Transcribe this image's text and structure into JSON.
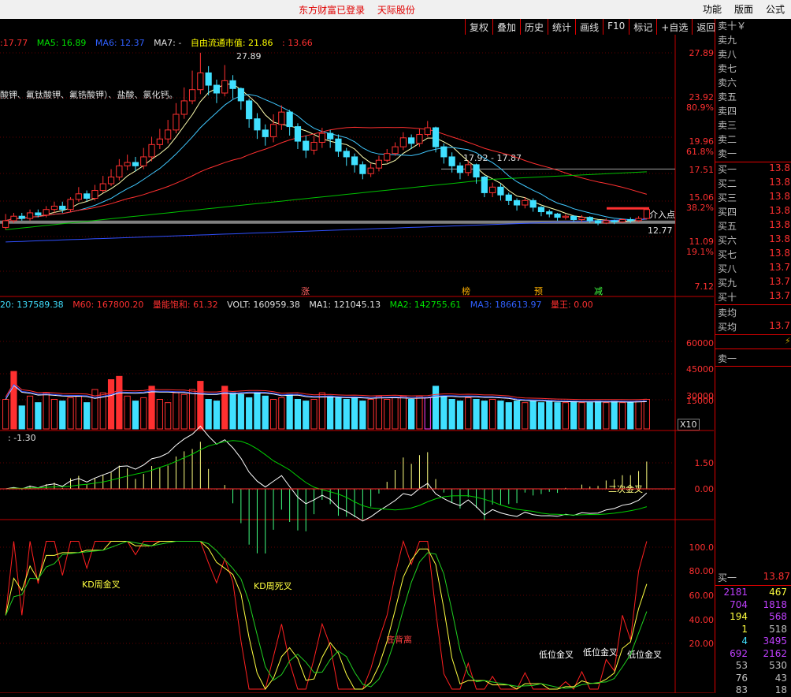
{
  "top": {
    "login": "东方财富已登录",
    "stock": "天际股份"
  },
  "top_menu": [
    "功能",
    "版面",
    "公式"
  ],
  "toolbar": [
    "复权",
    "叠加",
    "历史",
    "统计",
    "画线",
    "F10",
    "标记",
    "+自选",
    "返回"
  ],
  "main_legend": [
    {
      "t": ":17.77",
      "c": "#ff3030"
    },
    {
      "t": "MA5: 16.89",
      "c": "#00e000"
    },
    {
      "t": "MA6: 12.37",
      "c": "#3060ff"
    },
    {
      "t": "MA7: -",
      "c": "#e0e0e0"
    },
    {
      "t": "自由流通市值: 21.86",
      "c": "#ffff00"
    },
    {
      "t": ": 13.66",
      "c": "#ff3030"
    }
  ],
  "main_note": "酸钾、氟钛酸钾、氟锆酸钾）、盐酸、氯化钙。",
  "main_annotations": {
    "high": "27.89",
    "mid": "17.92 - 17.87",
    "low": "12.77",
    "entry": "介入点"
  },
  "price_axis": [
    "27.89",
    "23.92",
    "80.9%",
    "19.96",
    "61.8%",
    "17.51",
    "15.06",
    "38.2%",
    "11.09",
    "19.1%",
    "7.12"
  ],
  "event_markers": [
    "涨",
    "榜",
    "预",
    "减"
  ],
  "vol_legend": [
    {
      "t": "20: 137589.38",
      "c": "#40e0ff"
    },
    {
      "t": "M60: 167800.20",
      "c": "#ff3030"
    },
    {
      "t": "量能饱和: 61.32",
      "c": "#ff3030"
    },
    {
      "t": "VOLT: 160959.38",
      "c": "#e0e0e0"
    },
    {
      "t": "MA1: 121045.13",
      "c": "#e0e0e0"
    },
    {
      "t": "MA2: 142755.61",
      "c": "#00e000"
    },
    {
      "t": "MA3: 186613.97",
      "c": "#3060ff"
    },
    {
      "t": "量王: 0.00",
      "c": "#ff3030"
    }
  ],
  "vol_axis": [
    "60000",
    "45000",
    "30000",
    "15000"
  ],
  "vol_unit": "X10",
  "macd_legend": ": -1.30",
  "macd_axis": [
    "1.50",
    "0.00"
  ],
  "macd_note": "二次金叉",
  "kd_axis": [
    "100.0",
    "80.00",
    "60.00",
    "40.00",
    "20.00"
  ],
  "kd_labels": [
    "KD周金叉",
    "KD周死叉",
    "底背离",
    "低位金叉",
    "低位金叉",
    "低位金叉"
  ],
  "sell_levels": [
    "卖十￥",
    "卖九",
    "卖八",
    "卖七",
    "卖六",
    "卖五",
    "卖四",
    "卖三",
    "卖二",
    "卖一"
  ],
  "buy_levels": [
    {
      "l": "买一",
      "v": "13.8"
    },
    {
      "l": "买二",
      "v": "13.8"
    },
    {
      "l": "买三",
      "v": "13.8"
    },
    {
      "l": "买四",
      "v": "13.8"
    },
    {
      "l": "买五",
      "v": "13.8"
    },
    {
      "l": "买六",
      "v": "13.8"
    },
    {
      "l": "买七",
      "v": "13.8"
    },
    {
      "l": "买八",
      "v": "13.7"
    },
    {
      "l": "买九",
      "v": "13.7"
    },
    {
      "l": "买十",
      "v": "13.7"
    }
  ],
  "avg": [
    {
      "l": "卖均",
      "v": ""
    },
    {
      "l": "买均",
      "v": "13.7"
    }
  ],
  "queue_label": "卖一",
  "buy1_label": "买一",
  "buy1_price": "13.87",
  "queue": [
    {
      "a": "2181",
      "b": "467"
    },
    {
      "a": "704",
      "b": "1818"
    },
    {
      "a": "194",
      "b": "568"
    },
    {
      "a": "1",
      "b": "518"
    },
    {
      "a": "4",
      "b": "3495"
    },
    {
      "a": "692",
      "b": "2162"
    },
    {
      "a": "53",
      "b": "530"
    },
    {
      "a": "76",
      "b": "43"
    },
    {
      "a": "83",
      "b": "18"
    }
  ],
  "chart_data": {
    "type": "candlestick",
    "candles": [
      [
        12.3,
        12.9,
        13.5,
        12.1
      ],
      [
        12.9,
        13.3,
        13.6,
        12.7
      ],
      [
        13.3,
        13.1,
        13.6,
        12.9
      ],
      [
        13.1,
        13.6,
        13.9,
        12.9
      ],
      [
        13.6,
        13.4,
        13.9,
        13.2
      ],
      [
        13.4,
        13.9,
        14.2,
        13.2
      ],
      [
        13.9,
        14.2,
        14.6,
        13.6
      ],
      [
        14.2,
        13.9,
        14.6,
        13.6
      ],
      [
        13.9,
        14.8,
        15.0,
        13.7
      ],
      [
        14.8,
        15.3,
        15.9,
        14.6
      ],
      [
        15.3,
        14.9,
        15.6,
        14.6
      ],
      [
        14.9,
        15.6,
        16.1,
        14.7
      ],
      [
        15.6,
        16.2,
        16.9,
        15.4
      ],
      [
        16.2,
        16.8,
        17.5,
        16.0
      ],
      [
        16.8,
        17.8,
        18.4,
        16.5
      ],
      [
        17.8,
        18.1,
        18.8,
        17.4
      ],
      [
        18.1,
        17.8,
        18.6,
        17.3
      ],
      [
        17.8,
        18.6,
        19.4,
        17.5
      ],
      [
        18.6,
        19.7,
        20.4,
        18.2
      ],
      [
        19.7,
        20.2,
        21.1,
        19.3
      ],
      [
        20.2,
        21.0,
        21.9,
        19.8
      ],
      [
        21.0,
        22.4,
        23.4,
        20.7
      ],
      [
        22.4,
        23.6,
        24.8,
        22.0
      ],
      [
        23.6,
        24.6,
        26.3,
        23.3
      ],
      [
        24.6,
        26.1,
        27.9,
        24.2
      ],
      [
        26.1,
        25.0,
        26.7,
        24.1
      ],
      [
        25.0,
        24.3,
        25.5,
        23.4
      ],
      [
        24.3,
        25.4,
        26.8,
        24.0
      ],
      [
        25.4,
        24.7,
        25.9,
        23.8
      ],
      [
        24.7,
        23.6,
        24.8,
        22.8
      ],
      [
        23.6,
        22.0,
        23.8,
        21.2
      ],
      [
        22.0,
        21.0,
        22.5,
        20.2
      ],
      [
        21.0,
        20.4,
        21.5,
        19.6
      ],
      [
        20.4,
        21.5,
        22.4,
        19.9
      ],
      [
        21.5,
        22.6,
        23.2,
        21.0
      ],
      [
        22.6,
        21.3,
        22.8,
        20.5
      ],
      [
        21.3,
        20.0,
        21.6,
        19.3
      ],
      [
        20.0,
        19.2,
        20.5,
        18.5
      ],
      [
        19.2,
        19.9,
        20.5,
        18.8
      ],
      [
        19.9,
        20.7,
        21.2,
        19.4
      ],
      [
        20.7,
        20.2,
        21.0,
        19.4
      ],
      [
        20.2,
        19.1,
        20.6,
        18.6
      ],
      [
        19.1,
        18.6,
        19.4,
        17.8
      ],
      [
        18.6,
        17.9,
        18.9,
        17.2
      ],
      [
        17.9,
        17.1,
        18.2,
        16.6
      ],
      [
        17.1,
        17.6,
        18.0,
        16.8
      ],
      [
        17.6,
        18.3,
        18.7,
        17.3
      ],
      [
        18.3,
        18.9,
        19.3,
        18.1
      ],
      [
        18.9,
        19.5,
        19.9,
        18.7
      ],
      [
        19.5,
        20.3,
        20.8,
        19.2
      ],
      [
        20.3,
        19.8,
        20.6,
        19.3
      ],
      [
        19.8,
        20.6,
        21.1,
        19.5
      ],
      [
        20.6,
        21.2,
        21.8,
        20.4
      ],
      [
        21.2,
        19.5,
        21.3,
        19.0
      ],
      [
        19.5,
        18.6,
        19.8,
        18.0
      ],
      [
        18.6,
        17.8,
        19.0,
        17.2
      ],
      [
        17.8,
        17.2,
        18.1,
        16.6
      ],
      [
        17.2,
        17.9,
        18.3,
        16.9
      ],
      [
        17.9,
        16.8,
        18.0,
        16.2
      ],
      [
        16.8,
        15.4,
        16.9,
        15.0
      ],
      [
        15.4,
        15.9,
        16.3,
        15.0
      ],
      [
        15.9,
        15.2,
        16.2,
        14.7
      ],
      [
        15.2,
        14.7,
        15.4,
        14.3
      ],
      [
        14.7,
        14.3,
        14.9,
        13.8
      ],
      [
        14.3,
        14.7,
        15.0,
        14.0
      ],
      [
        14.7,
        14.1,
        14.9,
        13.7
      ],
      [
        14.1,
        13.7,
        14.2,
        13.3
      ],
      [
        13.7,
        13.5,
        13.9,
        13.2
      ],
      [
        13.5,
        13.2,
        13.6,
        12.9
      ],
      [
        13.2,
        13.3,
        13.5,
        13.0
      ],
      [
        13.3,
        13.0,
        13.4,
        12.8
      ],
      [
        13.0,
        13.2,
        13.4,
        12.8
      ],
      [
        13.2,
        12.9,
        13.3,
        12.7
      ],
      [
        12.9,
        12.7,
        13.0,
        12.5
      ],
      [
        12.7,
        12.9,
        13.1,
        12.6
      ],
      [
        12.9,
        12.8,
        13.0,
        12.6
      ],
      [
        12.8,
        13.0,
        13.1,
        12.7
      ],
      [
        13.0,
        12.9,
        13.2,
        12.7
      ],
      [
        12.9,
        13.1,
        13.3,
        12.8
      ],
      [
        13.1,
        13.9,
        14.0,
        13.0
      ]
    ],
    "volume": [
      18,
      35,
      14,
      20,
      16,
      22,
      18,
      17,
      19,
      20,
      16,
      24,
      22,
      30,
      32,
      20,
      17,
      19,
      26,
      18,
      16,
      22,
      21,
      24,
      29,
      18,
      17,
      26,
      22,
      21,
      19,
      22,
      20,
      18,
      19,
      21,
      18,
      17,
      18,
      22,
      20,
      19,
      18,
      19,
      17,
      18,
      20,
      18,
      19,
      20,
      18,
      20,
      19,
      26,
      20,
      18,
      17,
      19,
      18,
      17,
      18,
      17,
      16,
      17,
      16,
      17,
      16,
      17,
      16,
      16,
      17,
      16,
      16,
      17,
      16,
      17,
      16,
      16,
      17,
      18
    ],
    "price_range": [
      7.12,
      29.0
    ]
  }
}
